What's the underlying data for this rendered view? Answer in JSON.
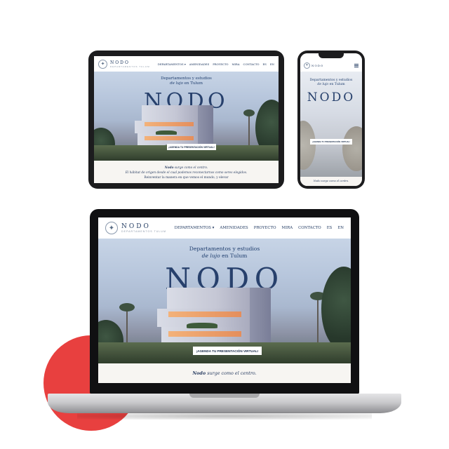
{
  "site": {
    "logo_name": "NODO",
    "logo_sub": "DEPARTAMENTOS TULUM",
    "menu": [
      "DEPARTAMENTOS ▾",
      "AMENIDADES",
      "PROYECTO",
      "MIRA",
      "CONTACTO",
      "ES",
      "EN"
    ],
    "tagline_1": "Departamentos y estudios",
    "tagline_2_italic": "de lujo",
    "tagline_2_rest": " en Tulum",
    "hero_title": "NODO",
    "cta": "¡AGENDA TU PRESENTACIÓN VIRTUAL!",
    "intro_1_italic": "Nodo",
    "intro_1_rest": " surge como el centro.",
    "intro_2": "El hábitat de origen desde el cual podemos reconectarnos como seres elegidos.",
    "intro_3": "Reinventar la manera en que vemos el mundo, y elevar"
  },
  "phone": {
    "intro": "Nodo surge como el centro."
  },
  "colors": {
    "accent_red": "#e8403f",
    "brand_navy": "#243d63"
  },
  "icons": {
    "phone_menu": "hamburger-icon",
    "logo": "nodo-logo-icon"
  }
}
